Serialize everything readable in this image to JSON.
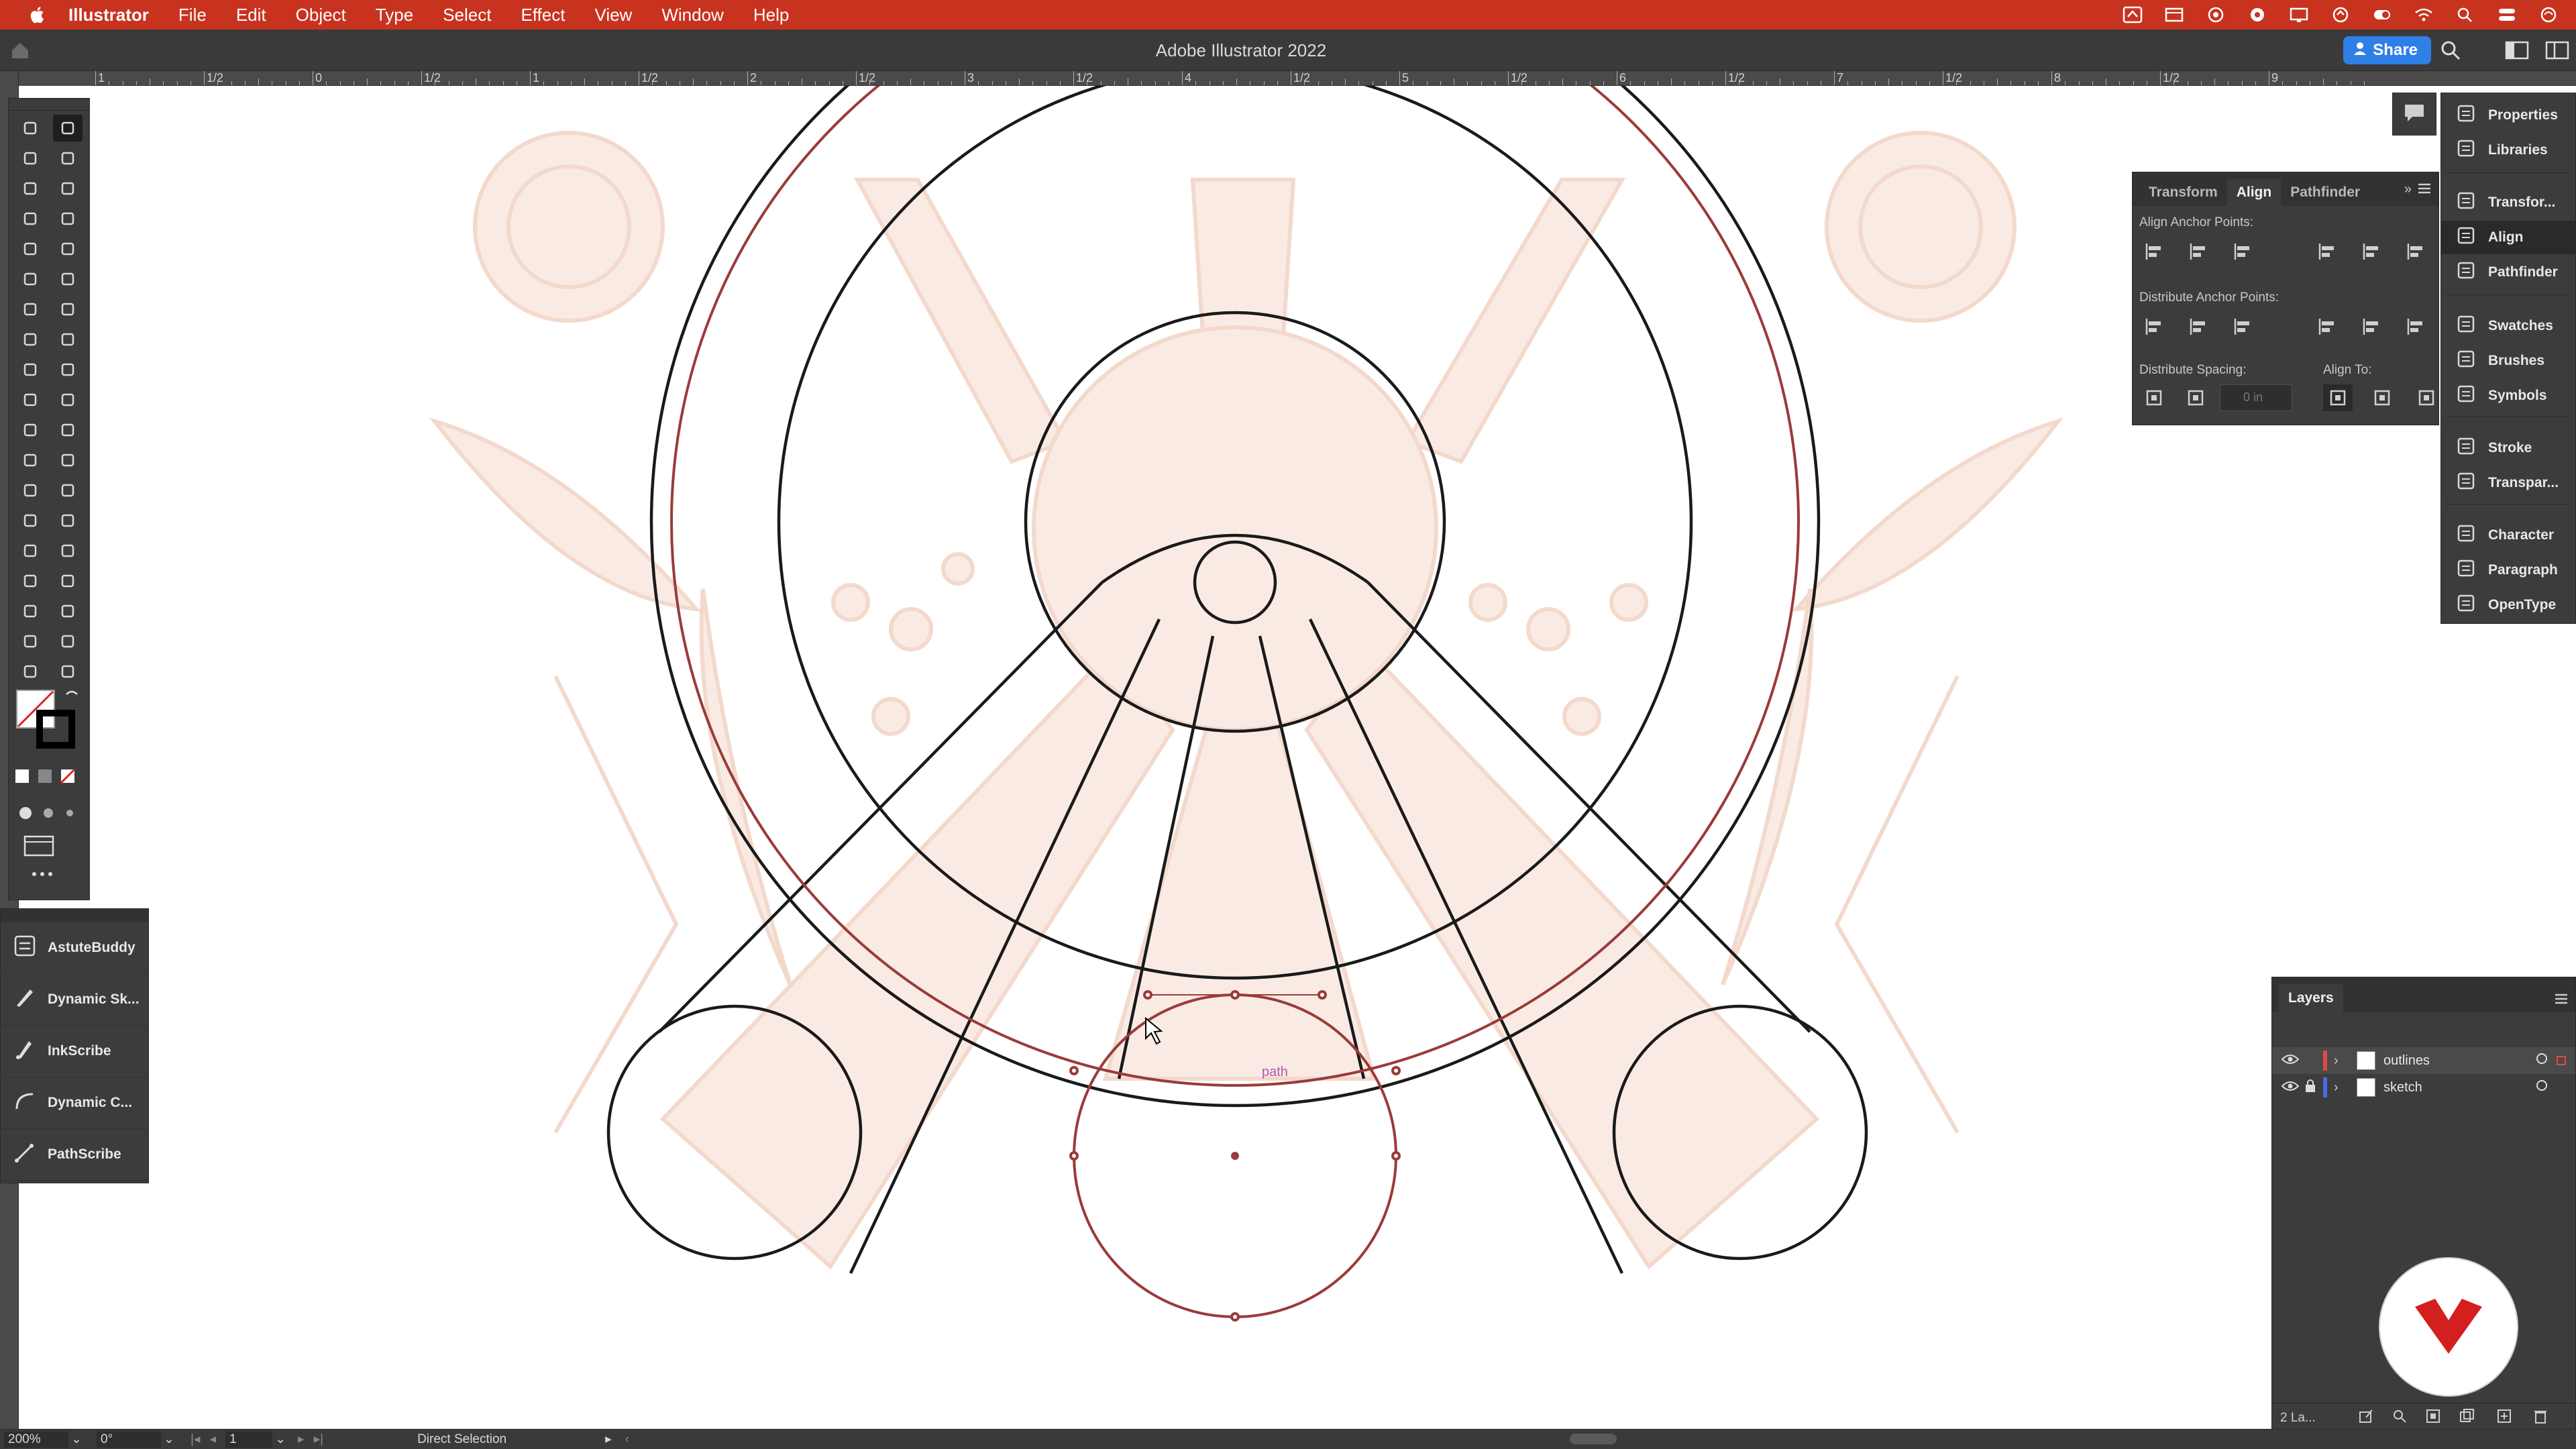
{
  "menubar": {
    "app_name": "Illustrator",
    "items": [
      "File",
      "Edit",
      "Object",
      "Type",
      "Select",
      "Effect",
      "View",
      "Window",
      "Help"
    ],
    "status_icons": [
      "adobe-stock-icon",
      "window-icon",
      "creative-cloud-icon",
      "record-icon",
      "screen-icon",
      "sync-icon",
      "toggle-icon",
      "wifi-icon",
      "search-icon",
      "control-center-icon",
      "siri-icon"
    ]
  },
  "titlebar": {
    "title": "Adobe Illustrator 2022",
    "share_label": "Share"
  },
  "ruler": {
    "labels": [
      "1",
      "1/2",
      "0",
      "1/2",
      "1",
      "1/2",
      "2",
      "1/2",
      "3",
      "1/2",
      "4",
      "1/2",
      "5",
      "1/2",
      "6",
      "1/2",
      "7",
      "1/2",
      "8",
      "1/2",
      "9"
    ]
  },
  "canvas": {
    "selection_label": "path",
    "stroke_color": "#1a1a1a",
    "selected_color": "#9b3a3a",
    "sketch_color": "#f3d9cc"
  },
  "plugins": {
    "items": [
      "AstuteBuddy",
      "Dynamic Sk...",
      "InkScribe",
      "Dynamic C...",
      "PathScribe"
    ]
  },
  "align_panel": {
    "tabs": [
      "Transform",
      "Align",
      "Pathfinder"
    ],
    "active_tab": "Align",
    "align_anchor_label": "Align Anchor Points:",
    "distribute_anchor_label": "Distribute Anchor Points:",
    "distribute_spacing_label": "Distribute Spacing:",
    "align_to_label": "Align To:",
    "spacing_value": "0 in"
  },
  "dock": {
    "items": [
      "Properties",
      "Libraries",
      "Transfor...",
      "Align",
      "Pathfinder",
      "Swatches",
      "Brushes",
      "Symbols",
      "Stroke",
      "Transpar...",
      "Character",
      "Paragraph",
      "OpenType"
    ],
    "active": "Align"
  },
  "layers_panel": {
    "tab": "Layers",
    "layers": [
      {
        "name": "outlines",
        "color": "#e0484a",
        "selected": true
      },
      {
        "name": "sketch",
        "color": "#4a6ae0",
        "selected": false
      }
    ],
    "footer": "2 La..."
  },
  "statusbar": {
    "zoom": "200%",
    "rotation": "0°",
    "artboard": "1",
    "tool": "Direct Selection"
  },
  "colors": {
    "menubar": "#c8331f",
    "panel": "#3c3c3c",
    "accent": "#2f7fe6",
    "brand_red": "#d41f1f"
  }
}
